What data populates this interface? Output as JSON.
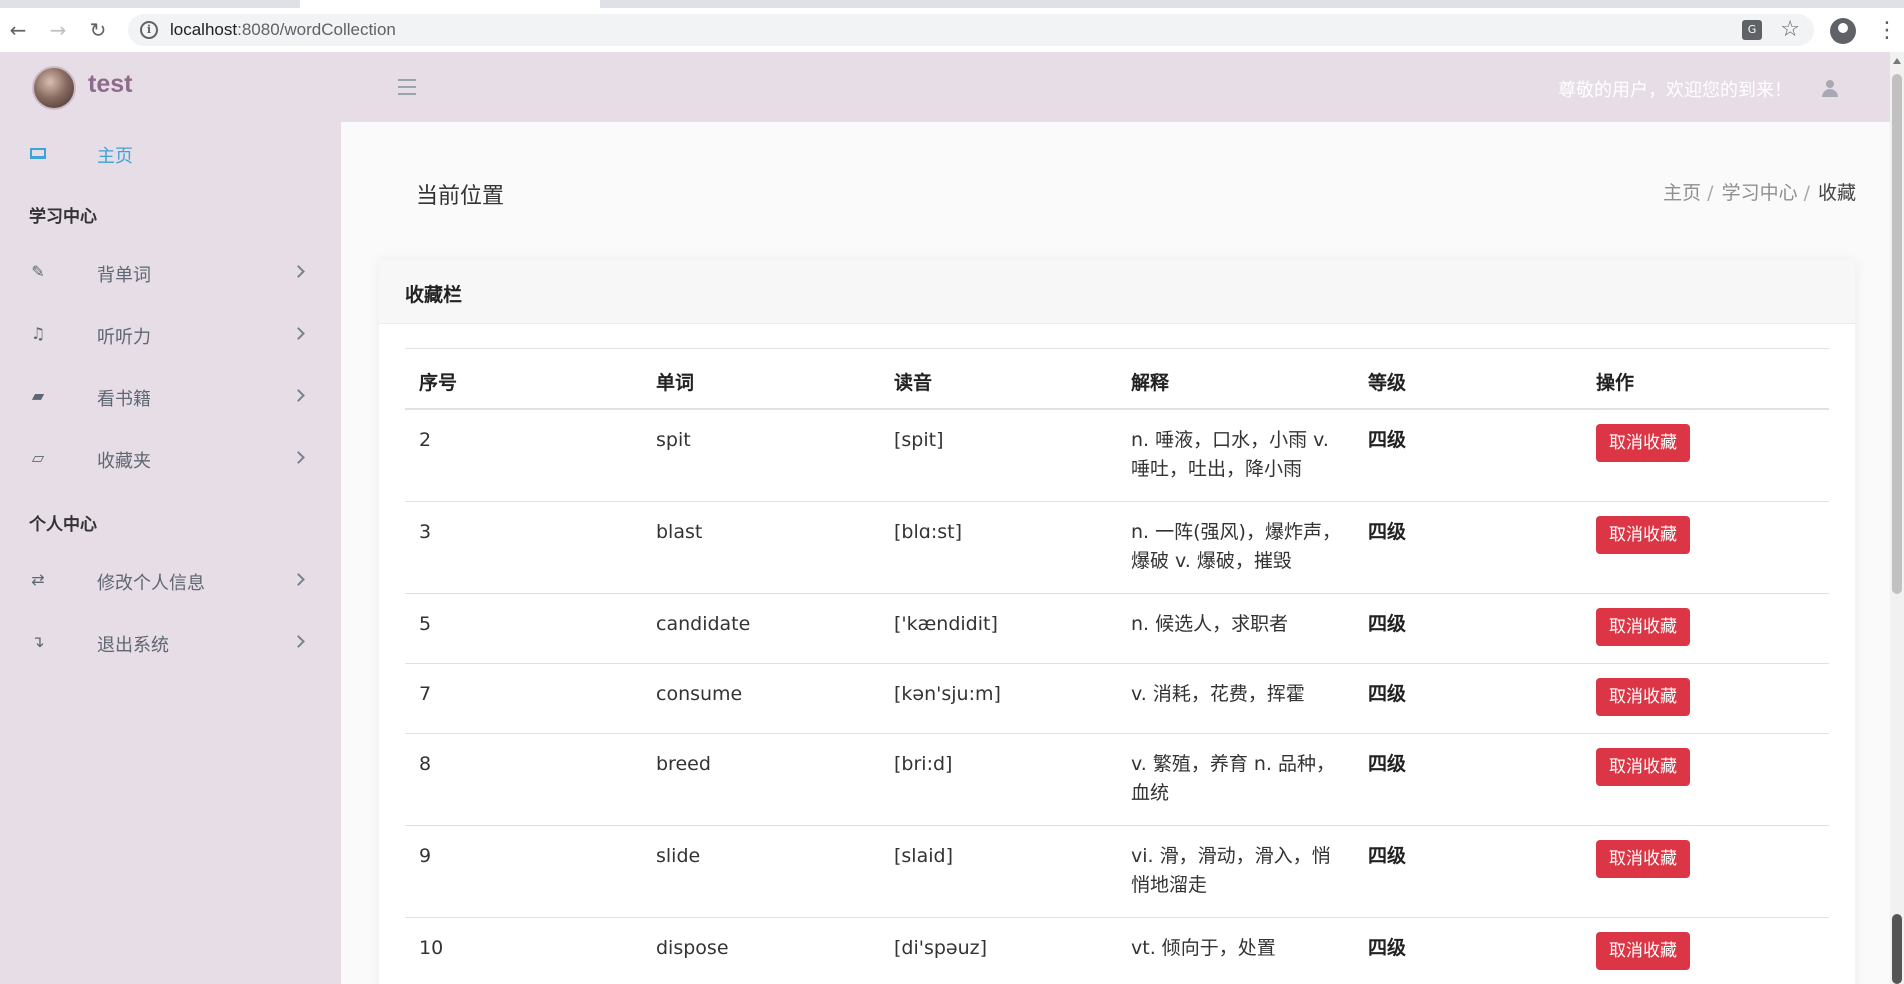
{
  "browser": {
    "url_host": "localhost",
    "url_path": ":8080/wordCollection",
    "translate_icon": "translate-icon",
    "star_icon": "star-icon"
  },
  "header": {
    "brand": "test",
    "welcome": "尊敬的用户，欢迎您的到来！"
  },
  "sidebar": {
    "home": "主页",
    "section_study": "学习中心",
    "items_study": [
      {
        "label": "背单词",
        "icon": "edit-icon"
      },
      {
        "label": "听听力",
        "icon": "headphones-icon"
      },
      {
        "label": "看书籍",
        "icon": "book-icon"
      },
      {
        "label": "收藏夹",
        "icon": "folder-open-icon"
      }
    ],
    "section_personal": "个人中心",
    "items_personal": [
      {
        "label": "修改个人信息",
        "icon": "exchange-icon"
      },
      {
        "label": "退出系统",
        "icon": "sign-out-icon"
      }
    ]
  },
  "main": {
    "location_title": "当前位置",
    "breadcrumb": [
      "主页",
      "学习中心",
      "收藏"
    ],
    "card_title": "收藏栏",
    "columns": [
      "序号",
      "单词",
      "读音",
      "解释",
      "等级",
      "操作"
    ],
    "action_label": "取消收藏",
    "rows": [
      {
        "id": "2",
        "word": "spit",
        "phonetic": "[spit]",
        "definition": "n. 唾液，口水，小雨 v. 唾吐，吐出，降小雨",
        "level": "四级"
      },
      {
        "id": "3",
        "word": "blast",
        "phonetic": "[blɑ:st]",
        "definition": "n. 一阵(强风)，爆炸声，爆破 v. 爆破，摧毁",
        "level": "四级"
      },
      {
        "id": "5",
        "word": "candidate",
        "phonetic": "['kændidit]",
        "definition": "n. 候选人，求职者",
        "level": "四级"
      },
      {
        "id": "7",
        "word": "consume",
        "phonetic": "[kən'sju:m]",
        "definition": "v. 消耗，花费，挥霍",
        "level": "四级"
      },
      {
        "id": "8",
        "word": "breed",
        "phonetic": "[bri:d]",
        "definition": "v. 繁殖，养育 n. 品种，血统",
        "level": "四级"
      },
      {
        "id": "9",
        "word": "slide",
        "phonetic": "[slaid]",
        "definition": "vi. 滑，滑动，滑入，悄悄地溜走",
        "level": "四级"
      },
      {
        "id": "10",
        "word": "dispose",
        "phonetic": "[di'spəuz]",
        "definition": "vt. 倾向于，处置",
        "level": "四级"
      }
    ]
  }
}
